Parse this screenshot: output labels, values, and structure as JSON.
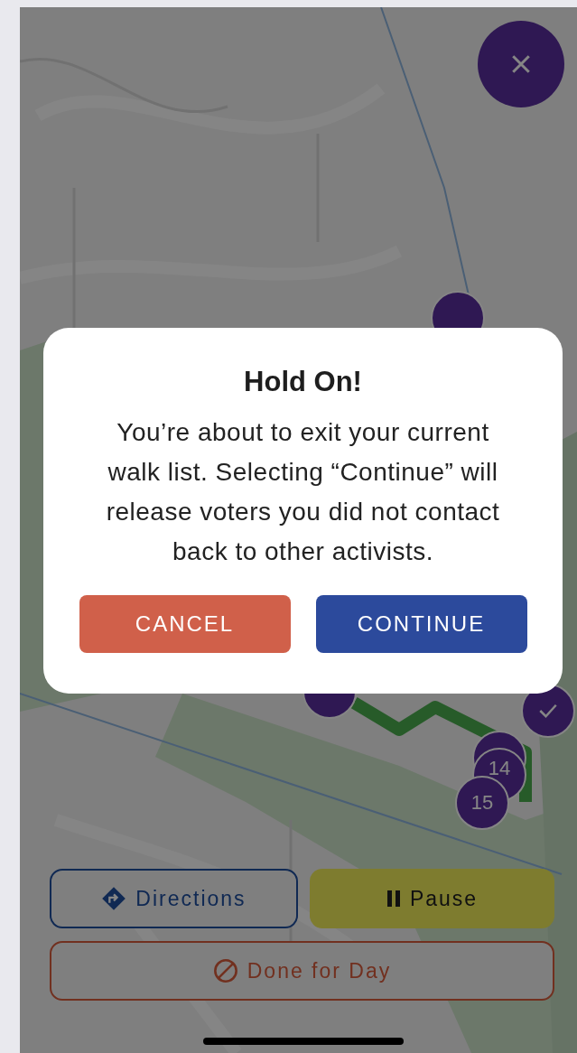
{
  "markers": [
    {
      "kind": "plain"
    },
    {
      "kind": "plain"
    },
    {
      "kind": "check"
    }
  ],
  "marker_cluster": [
    {
      "kind": "plain"
    },
    {
      "kind": "number",
      "label": "14"
    },
    {
      "kind": "number",
      "label": "15"
    }
  ],
  "actions": [
    {
      "kind": "directions",
      "label": "Directions"
    },
    {
      "kind": "pause",
      "label": "Pause"
    },
    {
      "kind": "done",
      "label": "Done for Day"
    }
  ],
  "dialog": {
    "title": "Hold On!",
    "message": "You’re about to exit your current walk list. Selecting “Continue” will release voters you did not contact back to other activists.",
    "buttons": [
      {
        "kind": "cancel",
        "label": "CANCEL"
      },
      {
        "kind": "continue",
        "label": "CONTINUE"
      }
    ]
  }
}
